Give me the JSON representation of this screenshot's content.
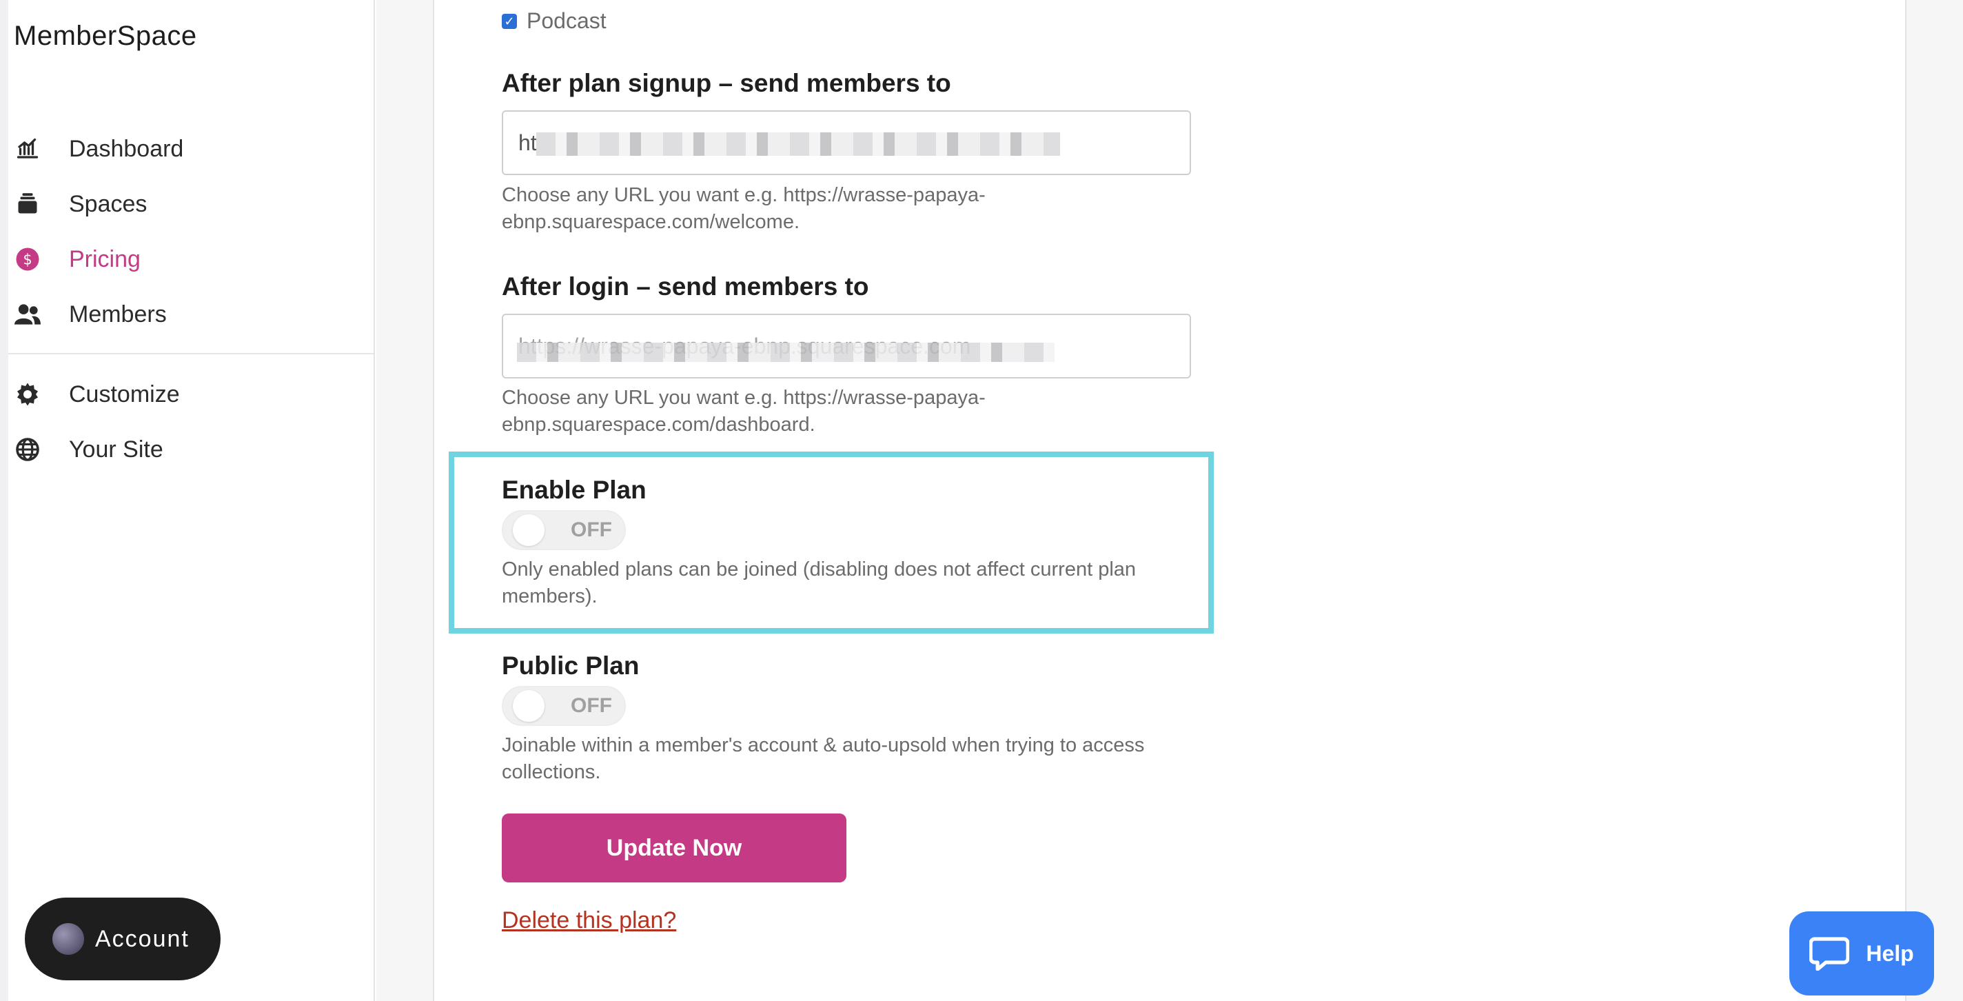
{
  "app": {
    "brand": "MemberSpace"
  },
  "sidebar": {
    "items": [
      {
        "label": "Dashboard",
        "icon": "chart-icon"
      },
      {
        "label": "Spaces",
        "icon": "layers-icon"
      },
      {
        "label": "Pricing",
        "icon": "dollar-icon",
        "active": true
      },
      {
        "label": "Members",
        "icon": "users-icon"
      },
      {
        "label": "Customize",
        "icon": "gear-icon"
      },
      {
        "label": "Your Site",
        "icon": "globe-icon"
      }
    ],
    "account_label": "Account"
  },
  "form": {
    "podcast_label": "Podcast",
    "signup_redirect": {
      "label": "After plan signup – send members to",
      "value": "ht",
      "helper": "Choose any URL you want e.g. https://wrasse-papaya-ebnp.squarespace.com/welcome."
    },
    "login_redirect": {
      "label": "After login – send members to",
      "value": "https://wrasse-papaya-ebnp.squarespace.com",
      "helper": "Choose any URL you want e.g. https://wrasse-papaya-ebnp.squarespace.com/dashboard."
    },
    "enable_plan": {
      "title": "Enable Plan",
      "state": "OFF",
      "helper": "Only enabled plans can be joined (disabling does not affect current plan members)."
    },
    "public_plan": {
      "title": "Public Plan",
      "state": "OFF",
      "helper": "Joinable within a member's account & auto-upsold when trying to access collections."
    },
    "update_label": "Update Now",
    "delete_label": "Delete this plan?"
  },
  "help": {
    "label": "Help"
  },
  "colors": {
    "accent": "#c43a84",
    "highlight": "#6fd4df",
    "help": "#3b82f6"
  }
}
